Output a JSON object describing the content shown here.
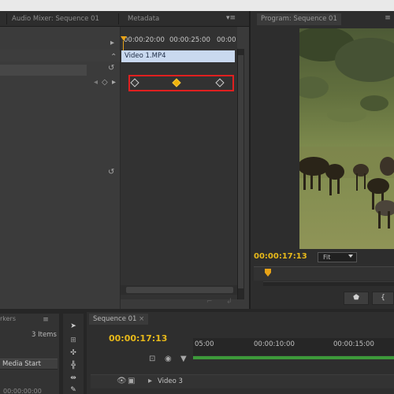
{
  "effect_panel": {
    "tabs": [
      "Audio Mixer: Sequence 01",
      "Metadata"
    ],
    "ruler_labels": [
      "00:00:20:00",
      "00:00:25:00",
      "00:00"
    ],
    "clip_name": "Video 1.MP4"
  },
  "program_monitor": {
    "tab": "Program: Sequence 01",
    "timecode": "00:00:17:13",
    "zoom": "Fit"
  },
  "project_panel": {
    "tab_fragment": "rkers",
    "items_count": "3 Items",
    "column_header": "Media Start",
    "row_timecode": "00:00:00:00"
  },
  "sequence": {
    "tab": "Sequence 01",
    "timecode": "00:00:17:13",
    "ruler_labels": [
      "05:00",
      "00:00:10:00",
      "00:00:15:00"
    ],
    "track_name": "Video 3"
  },
  "colors": {
    "accent_timecode": "#e8b91a",
    "keyframe_highlight_box": "#e02020",
    "keyframe_fill": "#f0b30a",
    "clip_bar": "#c9d9ef",
    "render_bar": "#3d9a3a"
  },
  "icons": [
    "panel-menu-icon",
    "reset-icon",
    "keyframe-nav-left-icon",
    "add-keyframe-icon",
    "keyframe-nav-right-icon",
    "playhead-icon",
    "selection-tool-icon",
    "marker-icon",
    "step-back-icon",
    "snap-icon",
    "eye-icon",
    "film-icon",
    "expand-triangle-icon"
  ]
}
